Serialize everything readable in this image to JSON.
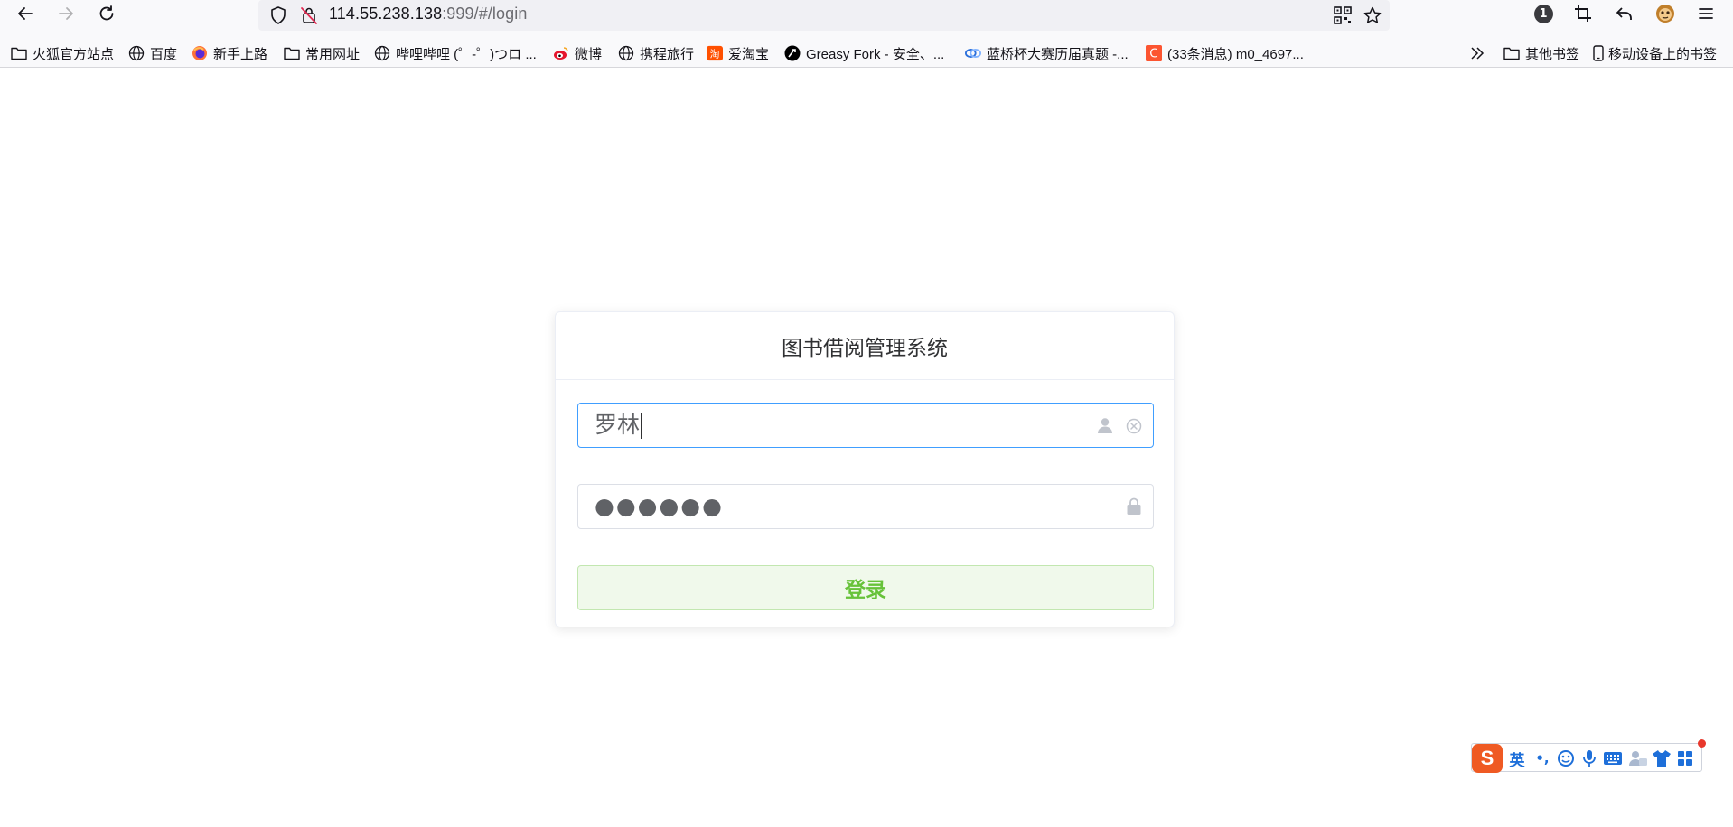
{
  "browser": {
    "url_host": "114.55.238.138",
    "url_rest": ":999/#/login",
    "notification_count": "1"
  },
  "bookmarks": [
    {
      "label": "火狐官方站点",
      "icon": "folder-icon"
    },
    {
      "label": "百度",
      "icon": "globe-icon"
    },
    {
      "label": "新手上路",
      "icon": "firefox-icon"
    },
    {
      "label": "常用网址",
      "icon": "folder-icon"
    },
    {
      "label": "哔哩哔哩 (゜-゜)つロ ...",
      "icon": "globe-icon"
    },
    {
      "label": "微博",
      "icon": "weibo-icon"
    },
    {
      "label": "携程旅行",
      "icon": "globe-icon"
    },
    {
      "label": "爱淘宝",
      "icon": "taobao-icon"
    },
    {
      "label": "Greasy Fork - 安全、...",
      "icon": "greasyfork-icon"
    },
    {
      "label": "蓝桥杯大赛历届真题 -...",
      "icon": "lanqiao-icon"
    },
    {
      "label": "(33条消息) m0_4697...",
      "icon": "csdn-icon"
    }
  ],
  "bookmarks_right": {
    "other": "其他书签",
    "mobile": "移动设备上的书签"
  },
  "login": {
    "title": "图书借阅管理系统",
    "username_value": "罗林",
    "password_mask": "●●●●●●",
    "submit_label": "登录"
  },
  "ime": {
    "logo_letter": "S",
    "mode": "英",
    "punct": "•,"
  },
  "colors": {
    "primary_blue": "#409eff",
    "success_green": "#67c23a",
    "success_bg": "#f0f9eb",
    "ime_orange": "#ef5a23"
  }
}
